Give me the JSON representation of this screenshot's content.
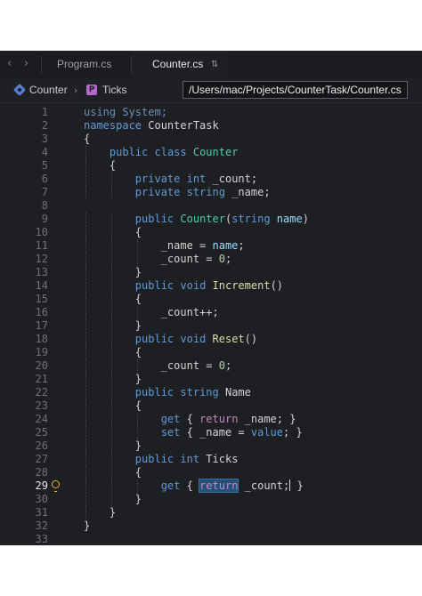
{
  "tabs": [
    {
      "label": "Program.cs",
      "active": false
    },
    {
      "label": "Counter.cs",
      "active": true
    }
  ],
  "breadcrumb": {
    "items": [
      "Counter",
      "Ticks"
    ],
    "path": "/Users/mac/Projects/CounterTask/Counter.cs"
  },
  "editor": {
    "current_line": 29,
    "lines": [
      {
        "n": "1",
        "code": [
          [
            "using",
            "t-dim"
          ],
          [
            " System;",
            "t-dim"
          ]
        ]
      },
      {
        "n": "2",
        "code": [
          [
            "namespace",
            "t-kw"
          ],
          [
            " CounterTask",
            "t-ns"
          ]
        ]
      },
      {
        "n": "3",
        "code": [
          [
            "{",
            ""
          ]
        ]
      },
      {
        "n": "4",
        "code": [
          [
            "    ",
            ""
          ],
          [
            "public",
            "t-kw"
          ],
          [
            " ",
            ""
          ],
          [
            "class",
            "t-kw"
          ],
          [
            " ",
            ""
          ],
          [
            "Counter",
            "t-type"
          ]
        ]
      },
      {
        "n": "5",
        "code": [
          [
            "    {",
            ""
          ]
        ]
      },
      {
        "n": "6",
        "code": [
          [
            "        ",
            ""
          ],
          [
            "private",
            "t-kw"
          ],
          [
            " ",
            ""
          ],
          [
            "int",
            "t-kw"
          ],
          [
            " _count;",
            ""
          ]
        ]
      },
      {
        "n": "7",
        "code": [
          [
            "        ",
            ""
          ],
          [
            "private",
            "t-kw"
          ],
          [
            " ",
            ""
          ],
          [
            "string",
            "t-kw"
          ],
          [
            " _name;",
            ""
          ]
        ]
      },
      {
        "n": "8",
        "code": []
      },
      {
        "n": "9",
        "code": [
          [
            "        ",
            ""
          ],
          [
            "public",
            "t-kw"
          ],
          [
            " ",
            ""
          ],
          [
            "Counter",
            "t-type"
          ],
          [
            "(",
            ""
          ],
          [
            "string",
            "t-kw"
          ],
          [
            " ",
            ""
          ],
          [
            "name",
            "t-var"
          ],
          [
            ")",
            ""
          ]
        ]
      },
      {
        "n": "10",
        "code": [
          [
            "        {",
            ""
          ]
        ]
      },
      {
        "n": "11",
        "code": [
          [
            "            _name = ",
            ""
          ],
          [
            "name",
            "t-var"
          ],
          [
            ";",
            ""
          ]
        ]
      },
      {
        "n": "12",
        "code": [
          [
            "            _count = ",
            ""
          ],
          [
            "0",
            "t-num"
          ],
          [
            ";",
            ""
          ]
        ]
      },
      {
        "n": "13",
        "code": [
          [
            "        }",
            ""
          ]
        ]
      },
      {
        "n": "14",
        "code": [
          [
            "        ",
            ""
          ],
          [
            "public",
            "t-kw"
          ],
          [
            " ",
            ""
          ],
          [
            "void",
            "t-kw"
          ],
          [
            " ",
            ""
          ],
          [
            "Increment",
            "t-fn"
          ],
          [
            "()",
            ""
          ]
        ]
      },
      {
        "n": "15",
        "code": [
          [
            "        {",
            ""
          ]
        ]
      },
      {
        "n": "16",
        "code": [
          [
            "            _count++;",
            ""
          ]
        ]
      },
      {
        "n": "17",
        "code": [
          [
            "        }",
            ""
          ]
        ]
      },
      {
        "n": "18",
        "code": [
          [
            "        ",
            ""
          ],
          [
            "public",
            "t-kw"
          ],
          [
            " ",
            ""
          ],
          [
            "void",
            "t-kw"
          ],
          [
            " ",
            ""
          ],
          [
            "Reset",
            "t-fn"
          ],
          [
            "()",
            ""
          ]
        ]
      },
      {
        "n": "19",
        "code": [
          [
            "        {",
            ""
          ]
        ]
      },
      {
        "n": "20",
        "code": [
          [
            "            _count = ",
            ""
          ],
          [
            "0",
            "t-num"
          ],
          [
            ";",
            ""
          ]
        ]
      },
      {
        "n": "21",
        "code": [
          [
            "        }",
            ""
          ]
        ]
      },
      {
        "n": "22",
        "code": [
          [
            "        ",
            ""
          ],
          [
            "public",
            "t-kw"
          ],
          [
            " ",
            ""
          ],
          [
            "string",
            "t-kw"
          ],
          [
            " Name",
            ""
          ]
        ]
      },
      {
        "n": "23",
        "code": [
          [
            "        {",
            ""
          ]
        ]
      },
      {
        "n": "24",
        "code": [
          [
            "            ",
            ""
          ],
          [
            "get",
            "t-kw"
          ],
          [
            " { ",
            ""
          ],
          [
            "return",
            "t-kw2"
          ],
          [
            " _name; }",
            ""
          ]
        ]
      },
      {
        "n": "25",
        "code": [
          [
            "            ",
            ""
          ],
          [
            "set",
            "t-kw"
          ],
          [
            " { _name = ",
            ""
          ],
          [
            "value",
            "t-kw"
          ],
          [
            "; }",
            ""
          ]
        ]
      },
      {
        "n": "26",
        "code": [
          [
            "        }",
            ""
          ]
        ]
      },
      {
        "n": "27",
        "code": [
          [
            "        ",
            ""
          ],
          [
            "public",
            "t-kw"
          ],
          [
            " ",
            ""
          ],
          [
            "int",
            "t-kw"
          ],
          [
            " Ticks",
            ""
          ]
        ]
      },
      {
        "n": "28",
        "code": [
          [
            "        {",
            ""
          ]
        ]
      },
      {
        "n": "29",
        "code": [
          [
            "            ",
            ""
          ],
          [
            "get",
            "t-kw"
          ],
          [
            " { ",
            ""
          ],
          [
            "return",
            "t-sel"
          ],
          [
            " _count;",
            ""
          ],
          [
            "|",
            "caret"
          ],
          [
            " }",
            ""
          ]
        ]
      },
      {
        "n": "30",
        "code": [
          [
            "        }",
            ""
          ]
        ]
      },
      {
        "n": "31",
        "code": [
          [
            "    }",
            ""
          ]
        ]
      },
      {
        "n": "32",
        "code": [
          [
            "}",
            ""
          ]
        ]
      },
      {
        "n": "33",
        "code": []
      }
    ]
  }
}
